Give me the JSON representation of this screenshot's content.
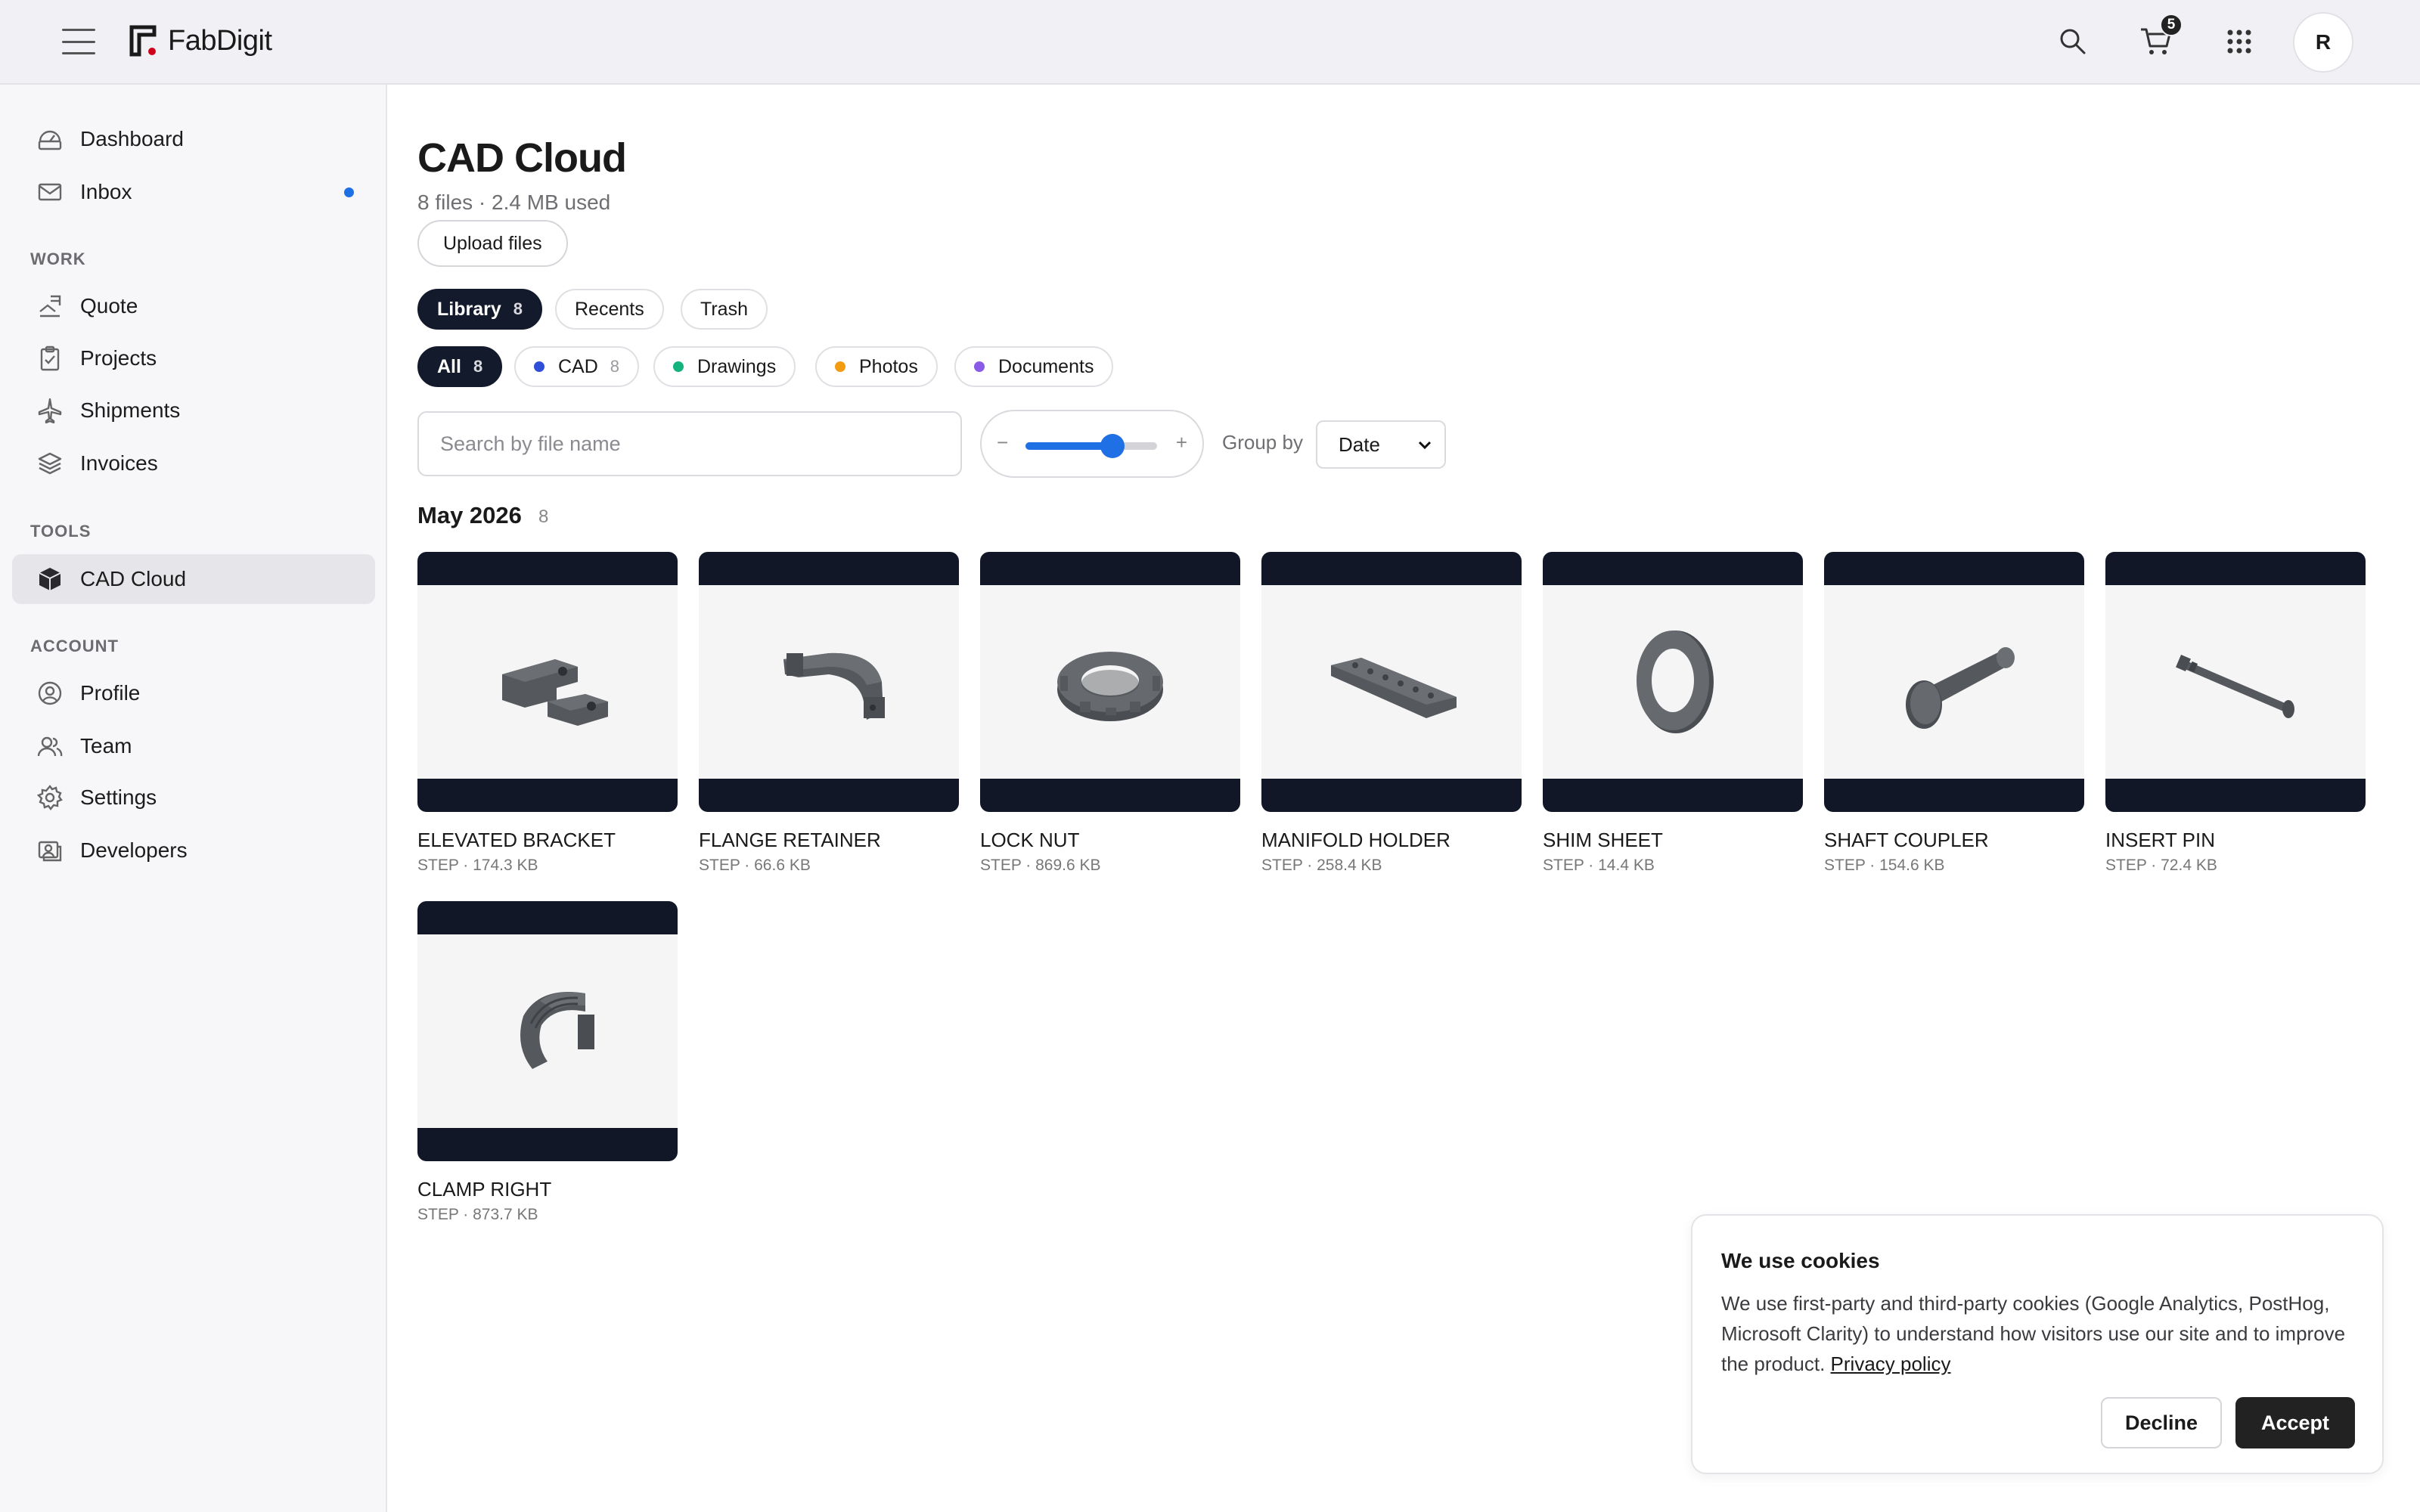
{
  "header": {
    "brand": "FabDigit",
    "cart_count": "5",
    "avatar_initial": "R",
    "icons": [
      "hamburger-icon",
      "search-icon",
      "cart-icon",
      "apps-grid-icon"
    ]
  },
  "sidebar": {
    "top_items": [
      {
        "label": "Dashboard",
        "icon": "dashboard-icon"
      },
      {
        "label": "Inbox",
        "icon": "mail-icon",
        "has_dot": true
      }
    ],
    "work_label": "WORK",
    "work_items": [
      {
        "label": "Quote",
        "icon": "quote-icon"
      },
      {
        "label": "Projects",
        "icon": "clipboard-icon"
      },
      {
        "label": "Shipments",
        "icon": "plane-icon"
      },
      {
        "label": "Invoices",
        "icon": "layers-icon"
      }
    ],
    "tools_label": "TOOLS",
    "tools_items": [
      {
        "label": "CAD Cloud",
        "icon": "cube-icon",
        "active": true
      }
    ],
    "account_label": "ACCOUNT",
    "account_items": [
      {
        "label": "Profile",
        "icon": "user-icon"
      },
      {
        "label": "Team",
        "icon": "team-icon"
      },
      {
        "label": "Settings",
        "icon": "gear-icon"
      },
      {
        "label": "Developers",
        "icon": "developer-icon"
      }
    ]
  },
  "main": {
    "title": "CAD Cloud",
    "subtitle": "8 files · 2.4 MB used",
    "upload_label": "Upload files",
    "tabs": [
      {
        "label": "Library",
        "count": "8",
        "active": true
      },
      {
        "label": "Recents",
        "count": ""
      },
      {
        "label": "Trash",
        "count": ""
      }
    ],
    "filters": [
      {
        "label": "All",
        "count": "8",
        "active": true,
        "dot": ""
      },
      {
        "label": "CAD",
        "count": "8",
        "dot": "#2f4fd8"
      },
      {
        "label": "Drawings",
        "count": "",
        "dot": "#14b37d"
      },
      {
        "label": "Photos",
        "count": "",
        "dot": "#f39c12"
      },
      {
        "label": "Documents",
        "count": "",
        "dot": "#8a5be6"
      }
    ],
    "search_placeholder": "Search by file name",
    "zoom_minus": "−",
    "zoom_plus": "+",
    "zoom_level": 0.66,
    "group_by_label": "Group by",
    "group_by_value": "Date",
    "group_title": "May 2026",
    "group_count": "8",
    "files": [
      {
        "name": "ELEVATED BRACKET",
        "meta": "STEP · 174.3 KB",
        "shape": "bracket"
      },
      {
        "name": "FLANGE RETAINER",
        "meta": "STEP · 66.6 KB",
        "shape": "retainer"
      },
      {
        "name": "LOCK NUT",
        "meta": "STEP · 869.6 KB",
        "shape": "nut"
      },
      {
        "name": "MANIFOLD HOLDER",
        "meta": "STEP · 258.4 KB",
        "shape": "holder"
      },
      {
        "name": "SHIM SHEET",
        "meta": "STEP · 14.4 KB",
        "shape": "ring"
      },
      {
        "name": "SHAFT COUPLER",
        "meta": "STEP · 154.6 KB",
        "shape": "coupler"
      },
      {
        "name": "INSERT PIN",
        "meta": "STEP · 72.4 KB",
        "shape": "pin"
      },
      {
        "name": "CLAMP RIGHT",
        "meta": "STEP · 873.7 KB",
        "shape": "clamp"
      }
    ]
  },
  "cookie": {
    "title": "We use cookies",
    "text": "We use first-party and third-party cookies (Google Analytics, PostHog, Microsoft Clarity) to understand how visitors use our site and to improve the product.",
    "link": "Privacy policy",
    "decline": "Decline",
    "accept": "Accept"
  },
  "colors": {
    "accent": "#1f6fe5",
    "dark": "#131a2b",
    "card_band": "#111727"
  }
}
